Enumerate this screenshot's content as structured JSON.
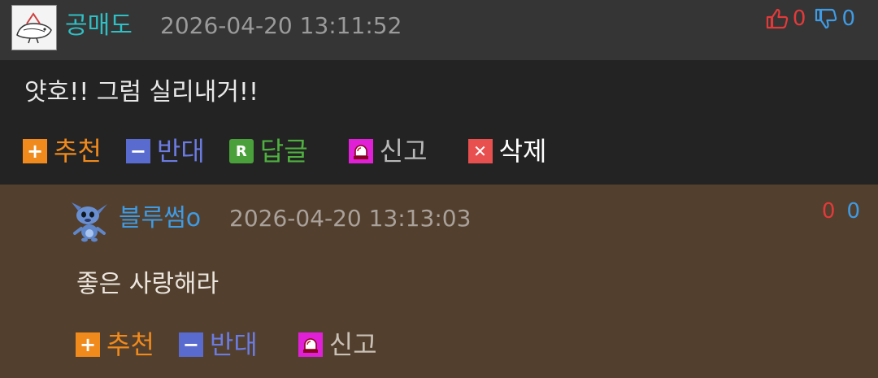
{
  "comment1": {
    "nickname": "공매도",
    "datetime": "2026-04-20 13:11:52",
    "upvotes": "0",
    "downvotes": "0",
    "text": "얏호!! 그럼 실리내거!!",
    "actions": {
      "recommend": "추천",
      "oppose": "반대",
      "reply": "답글",
      "report": "신고",
      "delete": "삭제"
    }
  },
  "comment2": {
    "nickname": "블루썸o",
    "datetime": "2026-04-20 13:13:03",
    "upvotes": "0",
    "downvotes": "0",
    "text": "좋은 사랑해라",
    "actions": {
      "recommend": "추천",
      "oppose": "반대",
      "report": "신고"
    }
  },
  "colors": {
    "nickname1": "#2fbfc4",
    "nickname2": "#3f9be4",
    "upvote": "#e23a3a",
    "downvote": "#3f9be4",
    "recommend": "#f08a1c",
    "oppose": "#6b7be0",
    "reply": "#4fb040",
    "reply_background": "#523f2e"
  },
  "icons": [
    "avatar-image",
    "thumbs-up-icon",
    "thumbs-down-icon",
    "plus-icon",
    "minus-icon",
    "reply-icon",
    "siren-icon",
    "delete-x-icon"
  ]
}
